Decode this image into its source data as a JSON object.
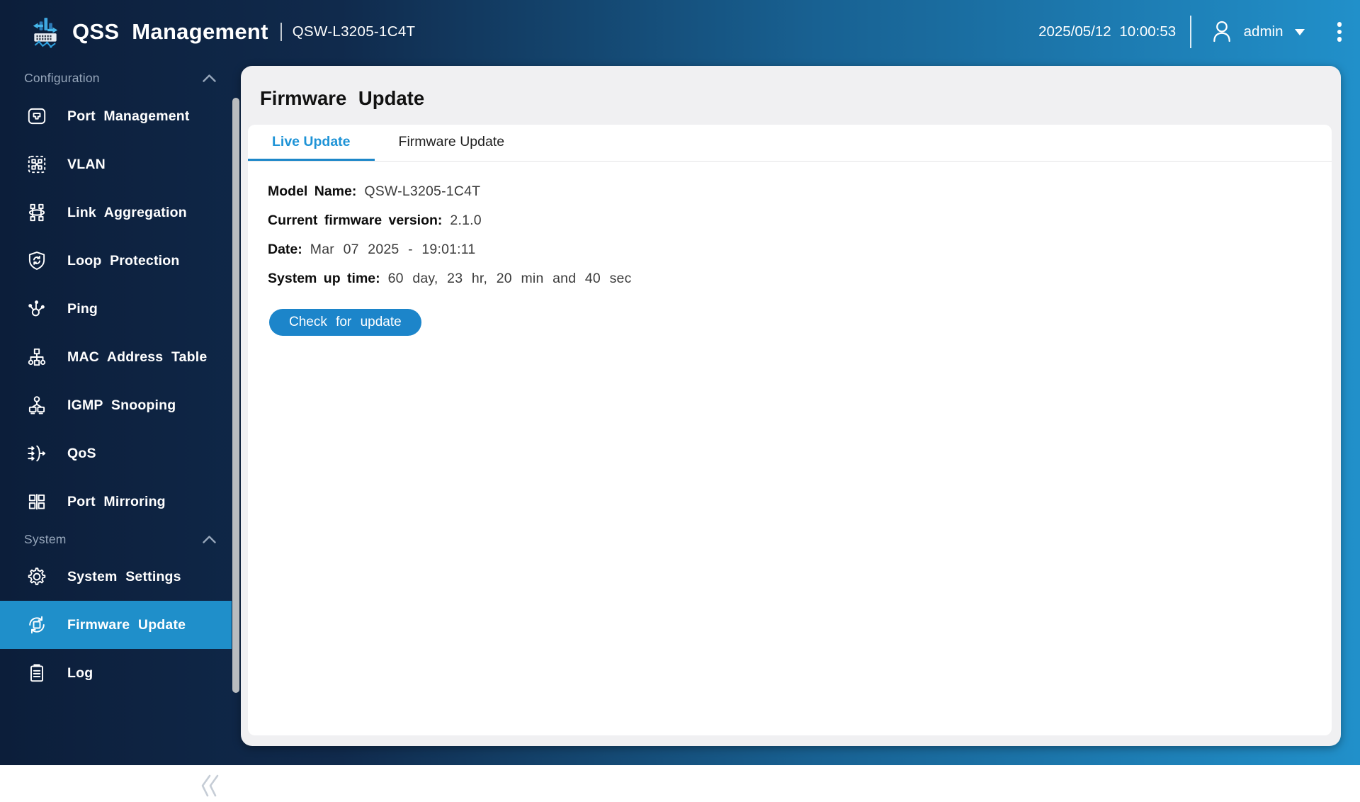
{
  "header": {
    "app_title": "QSS Management",
    "device_model": "QSW-L3205-1C4T",
    "datetime": "2025/05/12  10:00:53",
    "user": "admin"
  },
  "sidebar": {
    "sections": [
      {
        "label": "Configuration",
        "items": [
          {
            "label": "Port Management",
            "icon": "port-management-icon"
          },
          {
            "label": "VLAN",
            "icon": "vlan-icon"
          },
          {
            "label": "Link Aggregation",
            "icon": "link-aggregation-icon"
          },
          {
            "label": "Loop Protection",
            "icon": "loop-protection-icon"
          },
          {
            "label": "Ping",
            "icon": "ping-icon"
          },
          {
            "label": "MAC Address Table",
            "icon": "mac-address-table-icon"
          },
          {
            "label": "IGMP Snooping",
            "icon": "igmp-snooping-icon"
          },
          {
            "label": "QoS",
            "icon": "qos-icon"
          },
          {
            "label": "Port Mirroring",
            "icon": "port-mirroring-icon"
          }
        ]
      },
      {
        "label": "System",
        "items": [
          {
            "label": "System Settings",
            "icon": "system-settings-icon"
          },
          {
            "label": "Firmware Update",
            "icon": "firmware-update-icon",
            "active": true
          },
          {
            "label": "Log",
            "icon": "log-icon"
          }
        ]
      }
    ],
    "active_item": "Firmware Update"
  },
  "main": {
    "page_title": "Firmware Update",
    "tabs": [
      {
        "label": "Live Update",
        "active": true
      },
      {
        "label": "Firmware Update",
        "active": false
      }
    ],
    "info": [
      {
        "label": "Model Name:",
        "value": "QSW-L3205-1C4T"
      },
      {
        "label": "Current firmware version:",
        "value": "2.1.0"
      },
      {
        "label": "Date:",
        "value": "Mar 07 2025 - 19:01:11"
      },
      {
        "label": "System up time:",
        "value": "60 day, 23 hr, 20 min and 40 sec"
      }
    ],
    "check_button_label": "Check for update"
  },
  "colors": {
    "accent_blue": "#1c85ca",
    "active_nav_bg": "#1f8fca",
    "tab_active_text": "#1e93d6",
    "bg_gradient_left": "#0c1e3a",
    "bg_gradient_right": "#2190ca",
    "card_bg": "#f0f0f2",
    "panel_bg": "#ffffff"
  }
}
